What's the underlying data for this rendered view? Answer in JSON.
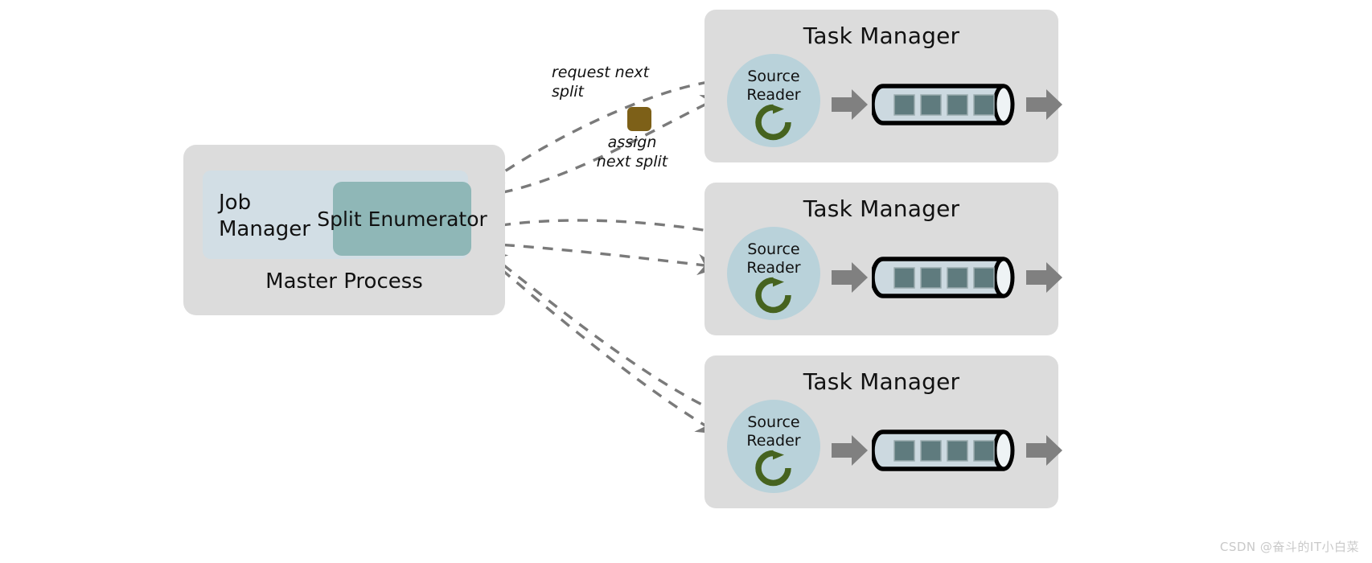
{
  "diagram": {
    "title": "Flink Source API architecture",
    "colors": {
      "panel_gray": "#dcdcdc",
      "job_manager_blue": "#d2dee5",
      "split_enumerator_teal": "#8fb7b7",
      "source_reader_circle": "#b9d2da",
      "pipe_fill": "#ccd9e0",
      "record_block": "#5f7b7e",
      "arrow_gray": "#808080",
      "dashed_line": "#7a7a7a",
      "split_chip_brown": "#7d6018",
      "loop_icon_green": "#46631f",
      "text": "#111111",
      "watermark": "#c9c9c9"
    },
    "master": {
      "process_label": "Master Process",
      "job_manager_label": "Job\nManager",
      "split_enumerator_label": "Split\nEnumerator"
    },
    "edges": {
      "request_label": "request next\nsplit",
      "assign_label": "assign\nnext split",
      "chip_name": "split-chip"
    },
    "task_managers": [
      {
        "title": "Task Manager",
        "source_reader_label": "Source\nReader",
        "record_count": 4
      },
      {
        "title": "Task Manager",
        "source_reader_label": "Source\nReader",
        "record_count": 4
      },
      {
        "title": "Task Manager",
        "source_reader_label": "Source\nReader",
        "record_count": 4
      }
    ],
    "watermark": "CSDN @奋斗的IT小白菜"
  }
}
